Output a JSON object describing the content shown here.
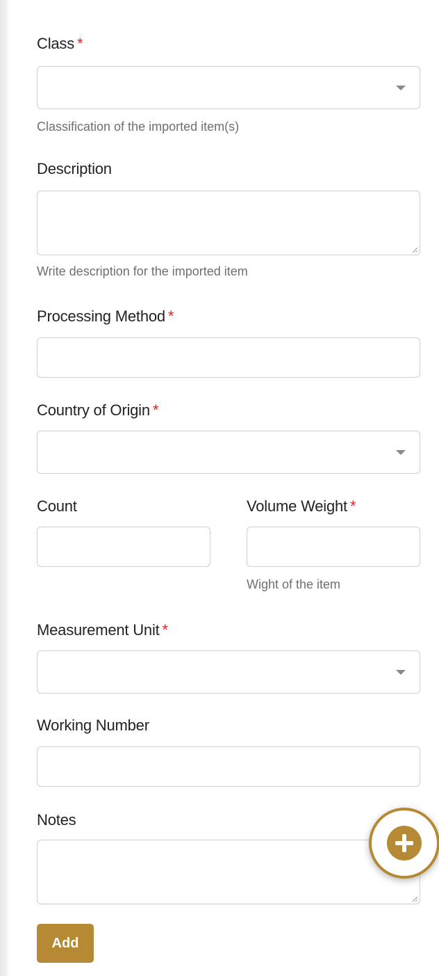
{
  "form": {
    "class": {
      "label": "Class",
      "required_mark": "*",
      "value": "",
      "help": "Classification of the imported item(s)",
      "icon": "chevron-down-icon"
    },
    "description": {
      "label": "Description",
      "value": "",
      "help": "Write description for the imported item"
    },
    "processing_method": {
      "label": "Processing Method",
      "required_mark": "*",
      "value": ""
    },
    "country_of_origin": {
      "label": "Country of Origin",
      "required_mark": "*",
      "value": "",
      "icon": "chevron-down-icon"
    },
    "count": {
      "label": "Count",
      "value": ""
    },
    "volume_weight": {
      "label": "Volume Weight",
      "required_mark": "*",
      "value": "",
      "help": "Wight of the item"
    },
    "measurement_unit": {
      "label": "Measurement Unit",
      "required_mark": "*",
      "value": "",
      "icon": "chevron-down-icon"
    },
    "working_number": {
      "label": "Working Number",
      "value": ""
    },
    "notes": {
      "label": "Notes",
      "value": ""
    },
    "add_button": {
      "label": "Add"
    }
  },
  "fab": {
    "icon": "plus-circle-icon"
  },
  "colors": {
    "accent": "#b68a35",
    "required": "#e02424",
    "border": "#cfcfcf",
    "help_text": "#6f6f6f"
  }
}
